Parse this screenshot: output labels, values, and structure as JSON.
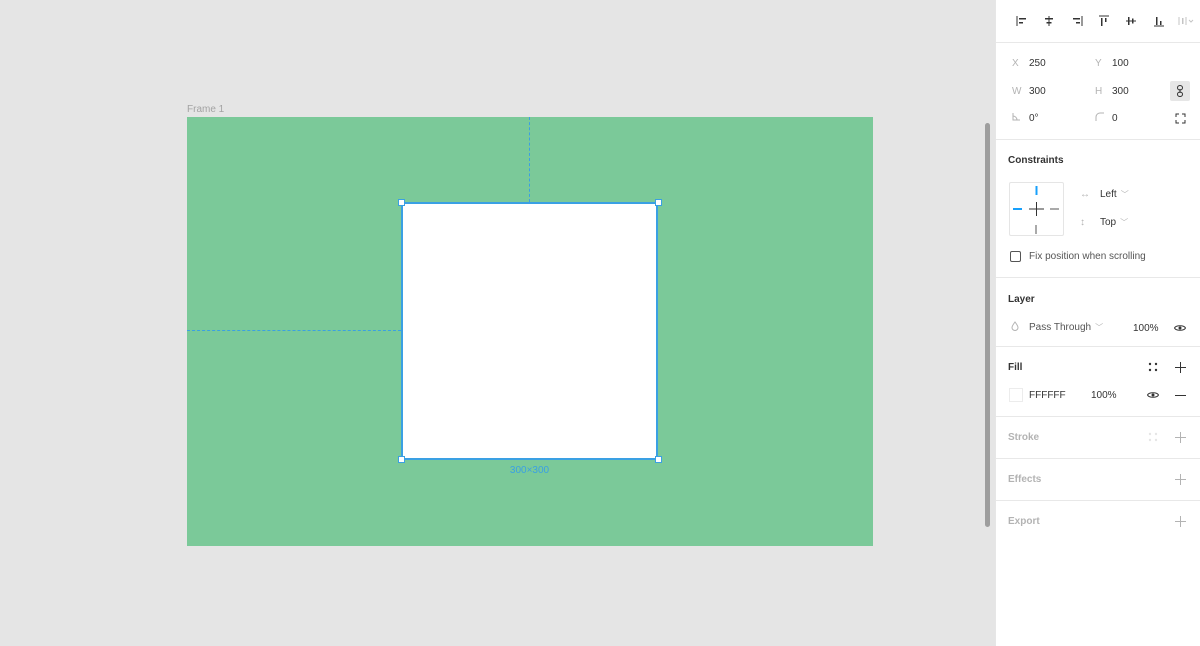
{
  "canvas": {
    "frame_label": "Frame 1",
    "frame_color": "#7bc999",
    "selection_color": "#3aa0e3",
    "selection_size_label": "300×300",
    "rect_fill": "#FFFFFF"
  },
  "panel": {
    "align_icons": [
      "align-left-icon",
      "align-horizontal-center-icon",
      "align-right-icon",
      "align-top-icon",
      "align-vertical-center-icon",
      "align-bottom-icon",
      "distribute-icon"
    ],
    "position": {
      "x_label": "X",
      "x_value": "250",
      "y_label": "Y",
      "y_value": "100",
      "w_label": "W",
      "w_value": "300",
      "h_label": "H",
      "h_value": "300",
      "rotation_value": "0°",
      "radius_value": "0"
    },
    "constraints": {
      "title": "Constraints",
      "horizontal": "Left",
      "vertical": "Top",
      "fix_position_label": "Fix position when scrolling",
      "fix_position_checked": false
    },
    "layer": {
      "title": "Layer",
      "blend_mode": "Pass Through",
      "opacity": "100%"
    },
    "fill": {
      "title": "Fill",
      "hex": "FFFFFF",
      "opacity": "100%"
    },
    "stroke": {
      "title": "Stroke"
    },
    "effects": {
      "title": "Effects"
    },
    "export": {
      "title": "Export"
    }
  }
}
